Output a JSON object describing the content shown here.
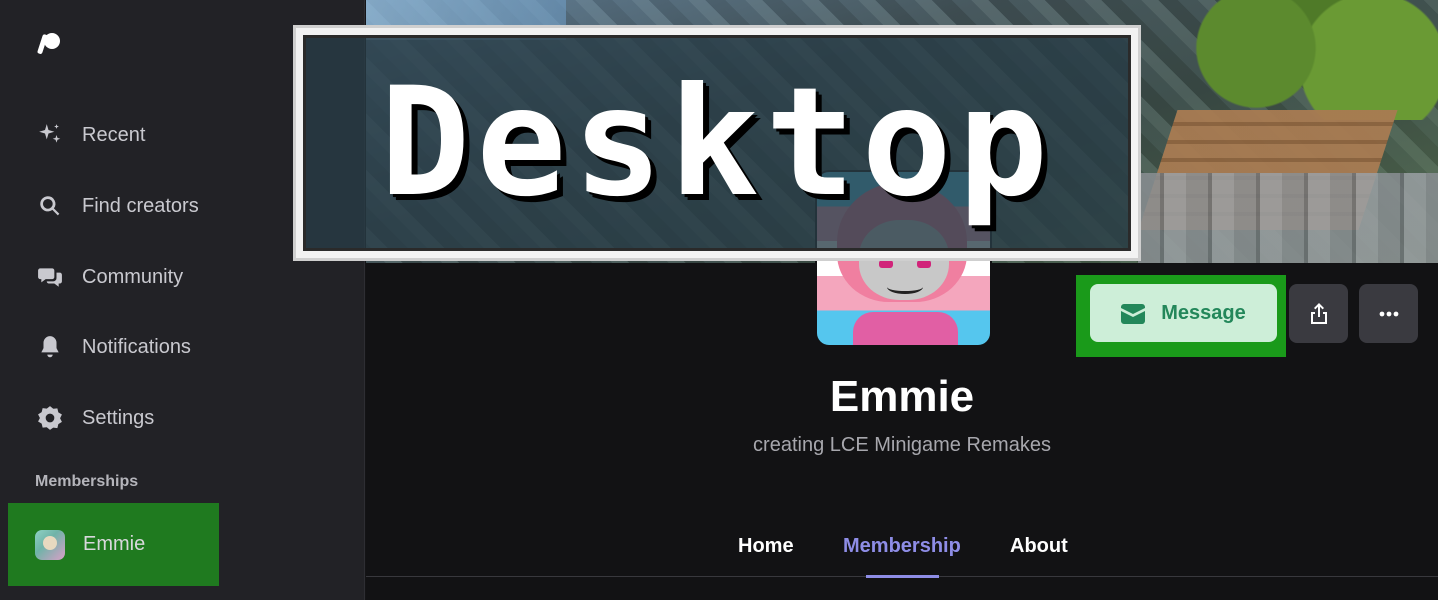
{
  "sidebar": {
    "nav": [
      {
        "label": "Recent",
        "icon": "sparkles-icon"
      },
      {
        "label": "Find creators",
        "icon": "search-icon"
      },
      {
        "label": "Community",
        "icon": "chat-bubbles-icon"
      },
      {
        "label": "Notifications",
        "icon": "bell-icon"
      },
      {
        "label": "Settings",
        "icon": "gear-icon"
      }
    ],
    "section_label": "Memberships",
    "memberships": [
      {
        "label": "Emmie"
      }
    ]
  },
  "overlay": {
    "label": "Desktop"
  },
  "profile": {
    "name": "Emmie",
    "tagline": "creating LCE Minigame Remakes",
    "message_label": "Message"
  },
  "tabs": [
    {
      "label": "Home",
      "active": false
    },
    {
      "label": "Membership",
      "active": true
    },
    {
      "label": "About",
      "active": false
    }
  ],
  "colors": {
    "accent": "#8e8de6",
    "message_bg": "#cdeed8",
    "message_text": "#23875a",
    "highlight": "#1a9a1a"
  }
}
